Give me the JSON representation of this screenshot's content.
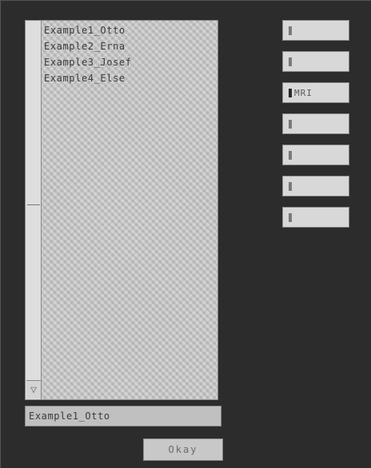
{
  "list": {
    "items": [
      {
        "label": "Example1_Otto"
      },
      {
        "label": "Example2_Erna"
      },
      {
        "label": "Example3_Josef"
      },
      {
        "label": "Example4_Else"
      }
    ]
  },
  "selection": {
    "value": "Example1_Otto"
  },
  "okay_button": {
    "label": "Okay"
  },
  "side_buttons": [
    {
      "label": ""
    },
    {
      "label": ""
    },
    {
      "label": "MRI"
    },
    {
      "label": ""
    },
    {
      "label": ""
    },
    {
      "label": ""
    },
    {
      "label": ""
    }
  ],
  "scrollbar": {
    "down_arrow_icon": "triangle-down-icon"
  }
}
